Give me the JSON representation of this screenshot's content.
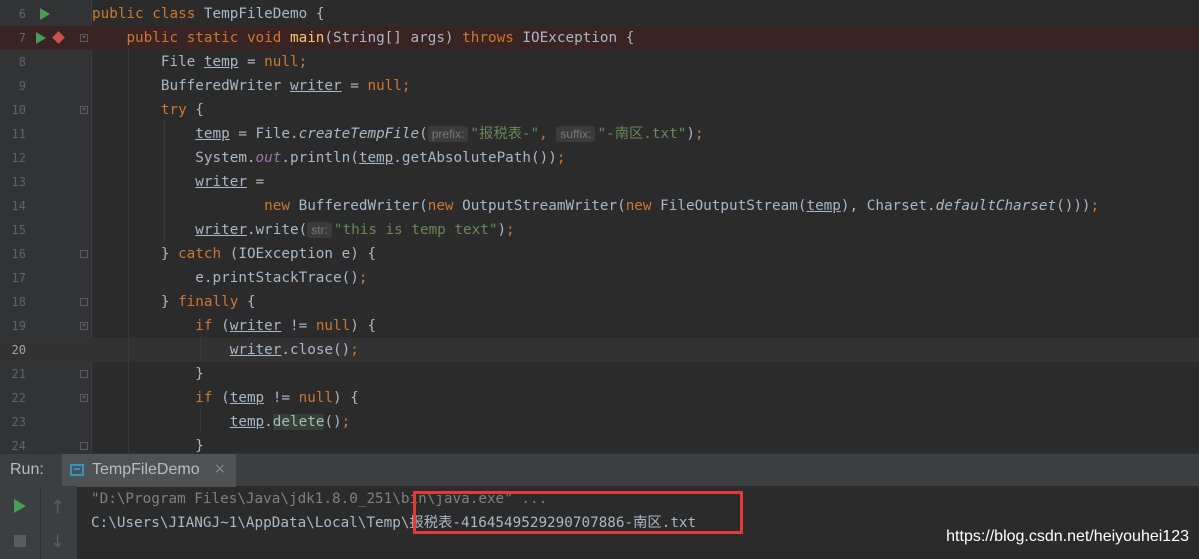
{
  "editor": {
    "lines": [
      {
        "n": "6",
        "tokens": [
          [
            "kw",
            "public"
          ],
          [
            "t",
            " "
          ],
          [
            "kw",
            "class"
          ],
          [
            "t",
            " TempFileDemo {"
          ]
        ]
      },
      {
        "n": "7",
        "tokens": [
          [
            "t",
            "    "
          ],
          [
            "kw",
            "public static void"
          ],
          [
            "t",
            " "
          ],
          [
            "fn",
            "main"
          ],
          [
            "t",
            "(String[] args) "
          ],
          [
            "kw",
            "throws"
          ],
          [
            "t",
            " IOException {"
          ]
        ]
      },
      {
        "n": "8",
        "tokens": [
          [
            "t",
            "        File "
          ],
          [
            "var",
            "temp"
          ],
          [
            "t",
            " = "
          ],
          [
            "kw",
            "null"
          ],
          [
            "kw",
            ";"
          ]
        ]
      },
      {
        "n": "9",
        "tokens": [
          [
            "t",
            "        BufferedWriter "
          ],
          [
            "var",
            "writer"
          ],
          [
            "t",
            " = "
          ],
          [
            "kw",
            "null"
          ],
          [
            "kw",
            ";"
          ]
        ]
      },
      {
        "n": "10",
        "tokens": [
          [
            "t",
            "        "
          ],
          [
            "kw",
            "try"
          ],
          [
            "t",
            " {"
          ]
        ]
      },
      {
        "n": "11",
        "tokens": [
          [
            "t",
            "            "
          ],
          [
            "var",
            "temp"
          ],
          [
            "t",
            " = File."
          ],
          [
            "it",
            "createTempFile"
          ],
          [
            "t",
            "("
          ],
          [
            "hint",
            "prefix:"
          ],
          [
            "str",
            "\"报税表-\""
          ],
          [
            "kw",
            ", "
          ],
          [
            "hint",
            "suffix:"
          ],
          [
            "str",
            "\"-南区.txt\""
          ],
          [
            "t",
            ")"
          ],
          [
            "kw",
            ";"
          ]
        ]
      },
      {
        "n": "12",
        "tokens": [
          [
            "t",
            "            System."
          ],
          [
            "stat",
            "out"
          ],
          [
            "t",
            ".println("
          ],
          [
            "var",
            "temp"
          ],
          [
            "t",
            ".getAbsolutePath())"
          ],
          [
            "kw",
            ";"
          ]
        ]
      },
      {
        "n": "13",
        "tokens": [
          [
            "t",
            "            "
          ],
          [
            "var",
            "writer"
          ],
          [
            "t",
            " ="
          ]
        ]
      },
      {
        "n": "14",
        "tokens": [
          [
            "t",
            "                    "
          ],
          [
            "kw",
            "new"
          ],
          [
            "t",
            " BufferedWriter("
          ],
          [
            "kw",
            "new"
          ],
          [
            "t",
            " OutputStreamWriter("
          ],
          [
            "kw",
            "new"
          ],
          [
            "t",
            " FileOutputStream("
          ],
          [
            "var",
            "temp"
          ],
          [
            "t",
            "), Charset."
          ],
          [
            "it",
            "defaultCharset"
          ],
          [
            "t",
            "()))"
          ],
          [
            "kw",
            ";"
          ]
        ]
      },
      {
        "n": "15",
        "tokens": [
          [
            "t",
            "            "
          ],
          [
            "var",
            "writer"
          ],
          [
            "t",
            ".write("
          ],
          [
            "hint",
            "str:"
          ],
          [
            "str",
            "\"this is temp text\""
          ],
          [
            "t",
            ")"
          ],
          [
            "kw",
            ";"
          ]
        ]
      },
      {
        "n": "16",
        "tokens": [
          [
            "t",
            "        } "
          ],
          [
            "kw",
            "catch"
          ],
          [
            "t",
            " (IOException e) {"
          ]
        ]
      },
      {
        "n": "17",
        "tokens": [
          [
            "t",
            "            e.printStackTrace()"
          ],
          [
            "kw",
            ";"
          ]
        ]
      },
      {
        "n": "18",
        "tokens": [
          [
            "t",
            "        } "
          ],
          [
            "kw",
            "finally"
          ],
          [
            "t",
            " {"
          ]
        ]
      },
      {
        "n": "19",
        "tokens": [
          [
            "t",
            "            "
          ],
          [
            "kw",
            "if"
          ],
          [
            "t",
            " ("
          ],
          [
            "var",
            "writer"
          ],
          [
            "t",
            " != "
          ],
          [
            "kw",
            "null"
          ],
          [
            "t",
            ") {"
          ]
        ]
      },
      {
        "n": "20",
        "tokens": [
          [
            "t",
            "                "
          ],
          [
            "var",
            "writer"
          ],
          [
            "t",
            ".close()"
          ],
          [
            "kw",
            ";"
          ]
        ]
      },
      {
        "n": "21",
        "tokens": [
          [
            "t",
            "            }"
          ]
        ]
      },
      {
        "n": "22",
        "tokens": [
          [
            "t",
            "            "
          ],
          [
            "kw",
            "if"
          ],
          [
            "t",
            " ("
          ],
          [
            "var",
            "temp"
          ],
          [
            "t",
            " != "
          ],
          [
            "kw",
            "null"
          ],
          [
            "t",
            ") {"
          ]
        ]
      },
      {
        "n": "23",
        "tokens": [
          [
            "t",
            "                "
          ],
          [
            "var",
            "temp"
          ],
          [
            "t",
            "."
          ],
          [
            "hl",
            "delete"
          ],
          [
            "t",
            "()"
          ],
          [
            "kw",
            ";"
          ]
        ]
      },
      {
        "n": "24",
        "tokens": [
          [
            "t",
            "            }"
          ]
        ]
      }
    ]
  },
  "run": {
    "label": "Run:",
    "tab_name": "TempFileDemo",
    "close_glyph": "×",
    "up_glyph": "↑",
    "down_glyph": "↓",
    "console_line_1": "\"D:\\Program Files\\Java\\jdk1.8.0_251\\bin\\java.exe\" ...",
    "console_line_2": "C:\\Users\\JIANGJ~1\\AppData\\Local\\Temp\\报税表-4164549529290707886-南区.txt"
  },
  "watermark": "https://blog.csdn.net/heiyouhei123",
  "colors": {
    "keyword": "#cc7832",
    "method": "#ffc66d",
    "string": "#6a8759",
    "text": "#a9b7c6",
    "static_field": "#9876aa",
    "highlight_box": "#e53935",
    "run_green": "#499c54"
  }
}
